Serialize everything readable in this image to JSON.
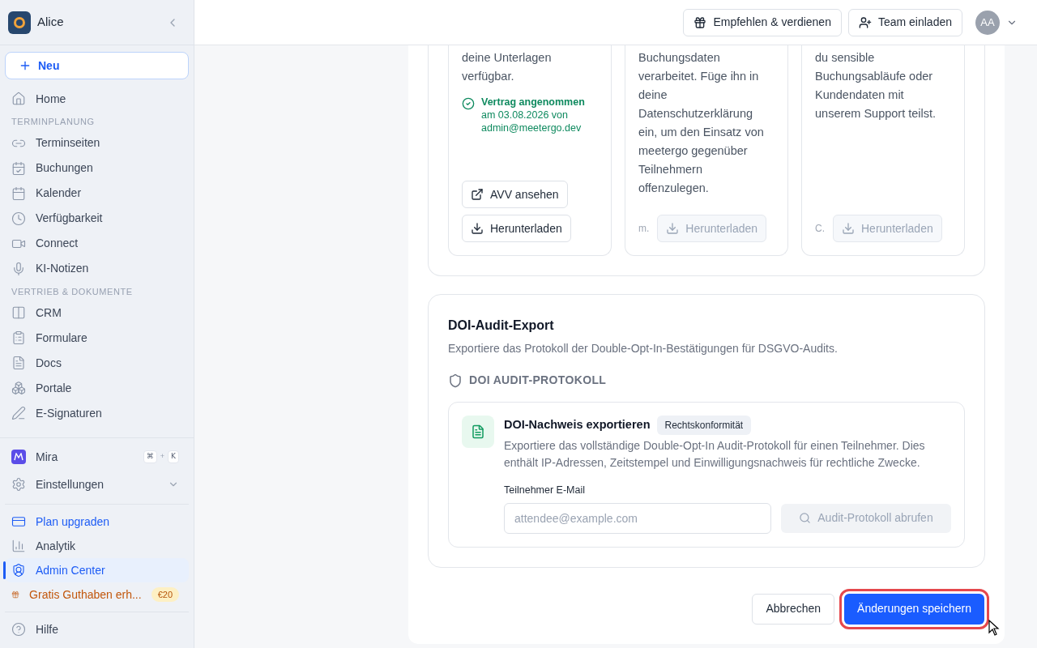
{
  "sidebar": {
    "workspace": "Alice",
    "new_button": "Neu",
    "nav": [
      {
        "kind": "item",
        "label": "Home",
        "selected": false
      },
      {
        "kind": "heading",
        "label": "TERMINPLANUNG"
      },
      {
        "kind": "item",
        "label": "Terminseiten",
        "selected": false
      },
      {
        "kind": "item",
        "label": "Buchungen",
        "selected": false
      },
      {
        "kind": "item",
        "label": "Kalender",
        "selected": false
      },
      {
        "kind": "item",
        "label": "Verfügbarkeit",
        "selected": false
      },
      {
        "kind": "item",
        "label": "Connect",
        "selected": false
      },
      {
        "kind": "item",
        "label": "KI-Notizen",
        "selected": false
      },
      {
        "kind": "heading",
        "label": "VERTRIEB & DOKUMENTE"
      },
      {
        "kind": "item",
        "label": "CRM",
        "selected": false
      },
      {
        "kind": "item",
        "label": "Formulare",
        "selected": false
      },
      {
        "kind": "item",
        "label": "Docs",
        "selected": false
      },
      {
        "kind": "item",
        "label": "Portale",
        "selected": false
      },
      {
        "kind": "item",
        "label": "E-Signaturen",
        "selected": false
      }
    ],
    "mira": {
      "label": "Mira",
      "shortcut": [
        "⌘",
        "+",
        "K"
      ]
    },
    "settings": {
      "label": "Einstellungen",
      "expanded": false
    },
    "links": [
      {
        "kind": "upgrade",
        "label": "Plan upgraden",
        "selected": false
      },
      {
        "kind": "plain",
        "label": "Analytik",
        "selected": false
      },
      {
        "kind": "plain",
        "label": "Admin Center",
        "selected": true
      },
      {
        "kind": "referral",
        "label": "Gratis Guthaben erh...",
        "badge": "€20",
        "selected": false
      }
    ],
    "help": "Hilfe"
  },
  "header": {
    "buttons": [
      "Empfehlen & verdienen",
      "Team einladen"
    ],
    "avatar": "AA"
  },
  "cards": [
    {
      "text": "deine Unterlagen verfügbar.",
      "status": {
        "title": "Vertrag angenommen",
        "detail": "am 03.08.2026 von admin@meetergo.dev"
      },
      "actions": [
        {
          "kind": "open",
          "label": "AVV ansehen",
          "disabled": false
        },
        {
          "kind": "download",
          "label": "Herunterladen",
          "disabled": false
        }
      ]
    },
    {
      "text": "Buchungsdaten verarbeitet. Füge ihn in deine Datenschutzerklärung ein, um den Einsatz von meetergo gegenüber Teilnehmern offenzulegen.",
      "note": "m.",
      "actions": [
        {
          "kind": "download",
          "label": "Herunterladen",
          "disabled": true
        }
      ]
    },
    {
      "text": "du sensible Buchungsabläufe oder Kundendaten mit unserem Support teilst.",
      "note": "C.",
      "actions": [
        {
          "kind": "download",
          "label": "Herunterladen",
          "disabled": true
        }
      ]
    }
  ],
  "doi": {
    "title": "DOI-Audit-Export",
    "description": "Exportiere das Protokoll der Double-Opt-In-Bestätigungen für DSGVO-Audits.",
    "subheading": "DOI AUDIT-PROTOKOLL",
    "export": {
      "title": "DOI-Nachweis exportieren",
      "badge": "Rechtskonformität",
      "description": "Exportiere das vollständige Double-Opt-In Audit-Protokoll für einen Teilnehmer. Dies enthält IP-Adressen, Zeitstempel und Einwilligungsnachweis für rechtliche Zwecke.",
      "email_label": "Teilnehmer E-Mail",
      "email_placeholder": "attendee@example.com",
      "fetch_button": {
        "label": "Audit-Protokoll abrufen",
        "disabled": true
      }
    }
  },
  "footer": {
    "cancel": "Abbrechen",
    "save": {
      "label": "Änderungen speichern",
      "focused": true
    }
  }
}
